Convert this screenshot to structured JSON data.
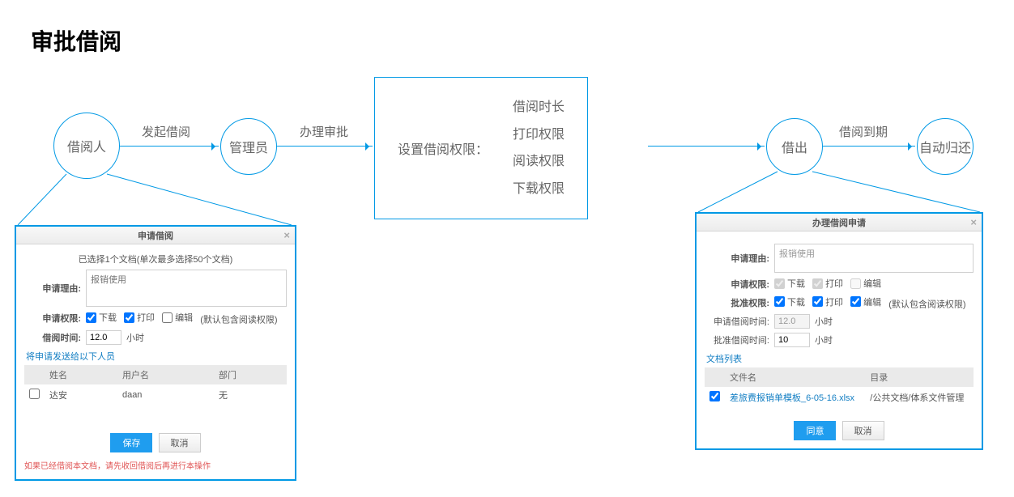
{
  "title": "审批借阅",
  "flow": {
    "nodes": {
      "borrower": "借阅人",
      "admin": "管理员",
      "perm_box_label": "设置借阅权限：",
      "perm_options": [
        "借阅时长",
        "打印权限",
        "阅读权限",
        "下载权限"
      ],
      "lend_out": "借出",
      "auto_return": "自动归还"
    },
    "edges": {
      "a": "发起借阅",
      "b": "办理审批",
      "c": "借阅到期"
    }
  },
  "dlg1": {
    "title": "申请借阅",
    "selected_info": "已选择1个文档(单次最多选择50个文档)",
    "reason_label": "申请理由:",
    "reason_placeholder": "报销使用",
    "perm_label": "申请权限:",
    "cb_download": "下载",
    "cb_print": "打印",
    "cb_edit": "编辑",
    "perm_hint": "(默认包含阅读权限)",
    "time_label": "借阅时间:",
    "time_value": "12.0",
    "time_unit": "小时",
    "send_to": "将申请发送给以下人员",
    "cols": {
      "name": "姓名",
      "user": "用户名",
      "dept": "部门"
    },
    "rows": [
      {
        "name": "达安",
        "user": "daan",
        "dept": "无"
      }
    ],
    "btn_save": "保存",
    "btn_cancel": "取消",
    "warning": "如果已经借阅本文档，请先收回借阅后再进行本操作"
  },
  "dlg2": {
    "title": "办理借阅申请",
    "reason_label": "申请理由:",
    "reason_value": "报销使用",
    "apply_perm_label": "申请权限:",
    "approve_perm_label": "批准权限:",
    "cb_download": "下载",
    "cb_print": "打印",
    "cb_edit": "编辑",
    "approve_hint": "(默认包含阅读权限)",
    "apply_time_label": "申请借阅时间:",
    "apply_time_value": "12.0",
    "approve_time_label": "批准借阅时间:",
    "approve_time_value": "10",
    "time_unit": "小时",
    "doc_list": "文档列表",
    "cols": {
      "file": "文件名",
      "dir": "目录"
    },
    "rows": [
      {
        "file": "差旅费报销单模板_6-05-16.xlsx",
        "dir": "/公共文档/体系文件管理"
      }
    ],
    "btn_agree": "同意",
    "btn_cancel": "取消"
  }
}
